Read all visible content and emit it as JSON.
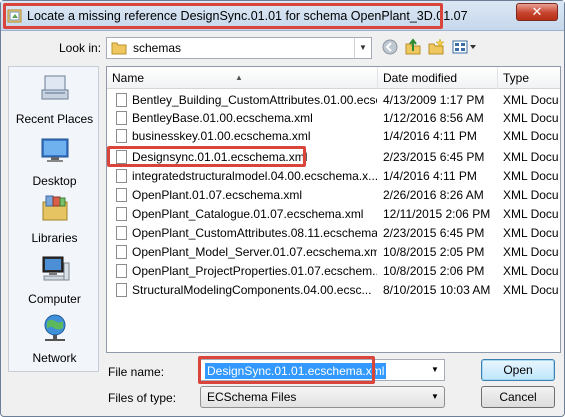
{
  "window": {
    "title": "Locate a missing reference DesignSync.01.01 for schema OpenPlant_3D.01.07",
    "close_label": "✕"
  },
  "lookin": {
    "label": "Look in:",
    "value": "schemas"
  },
  "toolbar_icons": [
    "back-icon",
    "up-folder-icon",
    "new-folder-icon",
    "views-menu-icon"
  ],
  "places": [
    {
      "label": "Recent Places",
      "icon": "recent-places-icon"
    },
    {
      "label": "Desktop",
      "icon": "desktop-icon"
    },
    {
      "label": "Libraries",
      "icon": "libraries-icon"
    },
    {
      "label": "Computer",
      "icon": "computer-icon"
    },
    {
      "label": "Network",
      "icon": "network-icon"
    }
  ],
  "columns": {
    "name": "Name",
    "date": "Date modified",
    "type": "Type"
  },
  "files": [
    {
      "name": "Bentley_Building_CustomAttributes.01.00.ecsch...",
      "date": "4/13/2009 1:17 PM",
      "type": "XML Docu"
    },
    {
      "name": "BentleyBase.01.00.ecschema.xml",
      "date": "1/12/2016 8:56 AM",
      "type": "XML Docu"
    },
    {
      "name": "businesskey.01.00.ecschema.xml",
      "date": "1/4/2016 4:11 PM",
      "type": "XML Docu"
    },
    {
      "name": "Designsync.01.01.ecschema.xml",
      "date": "2/23/2015 6:45 PM",
      "type": "XML Docu"
    },
    {
      "name": "integratedstructuralmodel.04.00.ecschema.x...",
      "date": "1/4/2016 4:11 PM",
      "type": "XML Docu"
    },
    {
      "name": "OpenPlant.01.07.ecschema.xml",
      "date": "2/26/2016 8:26 AM",
      "type": "XML Docu"
    },
    {
      "name": "OpenPlant_Catalogue.01.07.ecschema.xml",
      "date": "12/11/2015 2:06 PM",
      "type": "XML Docu"
    },
    {
      "name": "OpenPlant_CustomAttributes.08.11.ecschema...",
      "date": "2/23/2015 6:45 PM",
      "type": "XML Docu"
    },
    {
      "name": "OpenPlant_Model_Server.01.07.ecschema.xml",
      "date": "10/8/2015 2:05 PM",
      "type": "XML Docu"
    },
    {
      "name": "OpenPlant_ProjectProperties.01.07.ecschem...",
      "date": "10/8/2015 2:06 PM",
      "type": "XML Docu"
    },
    {
      "name": "StructuralModelingComponents.04.00.ecsc...",
      "date": "8/10/2015 10:03 AM",
      "type": "XML Docu"
    }
  ],
  "filename": {
    "label": "File name:",
    "value": "DesignSync.01.01.ecschema.xml"
  },
  "filetype": {
    "label": "Files of type:",
    "value": "ECSchema Files"
  },
  "buttons": {
    "open": "Open",
    "cancel": "Cancel"
  },
  "colors": {
    "highlight": "#d9453b",
    "selection": "#3399ff"
  }
}
